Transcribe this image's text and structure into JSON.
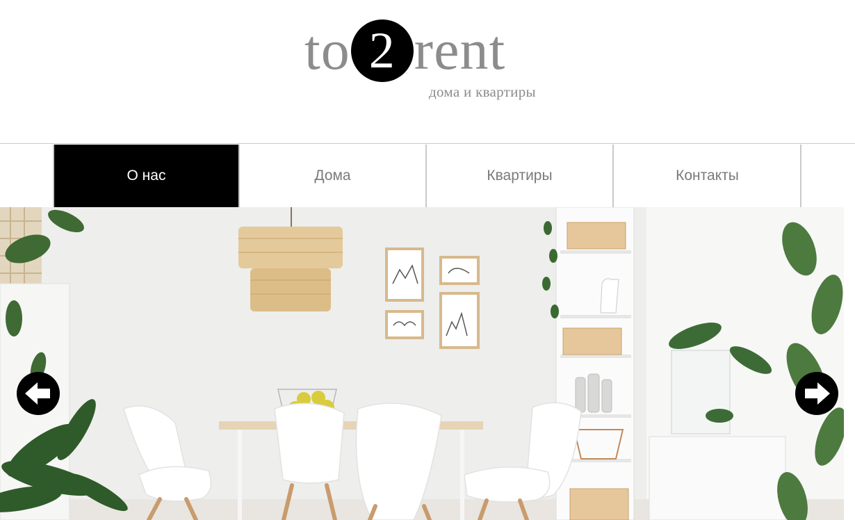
{
  "logo": {
    "text_before": "to",
    "circle_digit": "2",
    "text_after": "rent",
    "tagline": "дома и квартиры"
  },
  "nav": {
    "items": [
      {
        "label": "О нас",
        "active": true
      },
      {
        "label": "Дома",
        "active": false
      },
      {
        "label": "Квартиры",
        "active": false
      },
      {
        "label": "Контакты",
        "active": false
      }
    ]
  },
  "slider": {
    "prev_icon": "arrow-left-icon",
    "next_icon": "arrow-right-icon"
  },
  "colors": {
    "logo_gray": "#8c8c8c",
    "nav_active_bg": "#000000",
    "nav_active_text": "#ffffff",
    "nav_text": "#7a7a7a",
    "divider": "#c9c9c9"
  }
}
